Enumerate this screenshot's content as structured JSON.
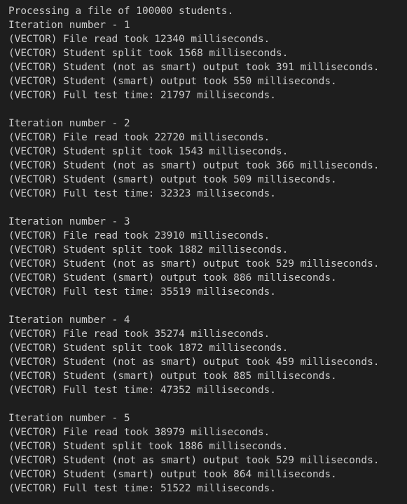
{
  "terminal": {
    "header": "Processing a file of 100000 students.",
    "iterations": [
      {
        "title": "Iteration number - 1",
        "lines": [
          "(VECTOR) File read took 12340 milliseconds.",
          "(VECTOR) Student split took 1568 milliseconds.",
          "(VECTOR) Student (not as smart) output took 391 milliseconds.",
          "(VECTOR) Student (smart) output took 550 milliseconds.",
          "(VECTOR) Full test time: 21797 milliseconds."
        ]
      },
      {
        "title": "Iteration number - 2",
        "lines": [
          "(VECTOR) File read took 22720 milliseconds.",
          "(VECTOR) Student split took 1543 milliseconds.",
          "(VECTOR) Student (not as smart) output took 366 milliseconds.",
          "(VECTOR) Student (smart) output took 509 milliseconds.",
          "(VECTOR) Full test time: 32323 milliseconds."
        ]
      },
      {
        "title": "Iteration number - 3",
        "lines": [
          "(VECTOR) File read took 23910 milliseconds.",
          "(VECTOR) Student split took 1882 milliseconds.",
          "(VECTOR) Student (not as smart) output took 529 milliseconds.",
          "(VECTOR) Student (smart) output took 886 milliseconds.",
          "(VECTOR) Full test time: 35519 milliseconds."
        ]
      },
      {
        "title": "Iteration number - 4",
        "lines": [
          "(VECTOR) File read took 35274 milliseconds.",
          "(VECTOR) Student split took 1872 milliseconds.",
          "(VECTOR) Student (not as smart) output took 459 milliseconds.",
          "(VECTOR) Student (smart) output took 885 milliseconds.",
          "(VECTOR) Full test time: 47352 milliseconds."
        ]
      },
      {
        "title": "Iteration number - 5",
        "lines": [
          "(VECTOR) File read took 38979 milliseconds.",
          "(VECTOR) Student split took 1886 milliseconds.",
          "(VECTOR) Student (not as smart) output took 529 milliseconds.",
          "(VECTOR) Student (smart) output took 864 milliseconds.",
          "(VECTOR) Full test time: 51522 milliseconds."
        ]
      }
    ]
  },
  "colors": {
    "background": "#1e1e1e",
    "text": "#cccccc"
  }
}
